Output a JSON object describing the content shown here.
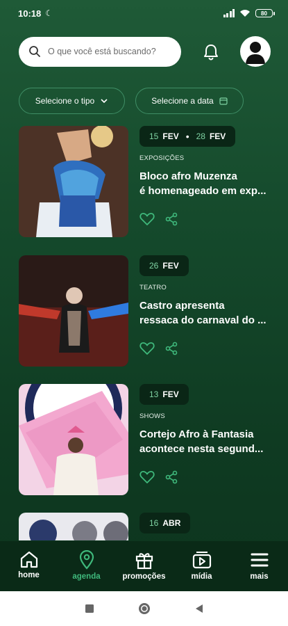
{
  "status_bar": {
    "time": "10:18",
    "battery": "80"
  },
  "search": {
    "placeholder": "O que você está buscando?"
  },
  "filters": {
    "type_label": "Selecione o tipo",
    "date_label": "Selecione a data"
  },
  "events": [
    {
      "date_start_day": "15",
      "date_start_month": "FEV",
      "date_end_day": "28",
      "date_end_month": "FEV",
      "category": "EXPOSIÇÕES",
      "title_line1": "Bloco afro Muzenza",
      "title_line2": "é homenageado em exp..."
    },
    {
      "date_start_day": "26",
      "date_start_month": "FEV",
      "category": "TEATRO",
      "title_line1": "Castro apresenta",
      "title_line2": "ressaca do carnaval do ..."
    },
    {
      "date_start_day": "13",
      "date_start_month": "FEV",
      "category": "SHOWS",
      "title_line1": "Cortejo Afro à Fantasia",
      "title_line2": "acontece nesta segund..."
    },
    {
      "date_start_day": "16",
      "date_start_month": "ABR"
    }
  ],
  "nav": [
    {
      "label": "home",
      "icon": "home-icon"
    },
    {
      "label": "agenda",
      "icon": "map-pin-icon",
      "active": true
    },
    {
      "label": "promoções",
      "icon": "gift-icon"
    },
    {
      "label": "mídia",
      "icon": "play-icon"
    },
    {
      "label": "mais",
      "icon": "menu-icon"
    }
  ],
  "colors": {
    "accent": "#3fb97c",
    "background": "#154a2c",
    "badge": "#0a2616"
  }
}
